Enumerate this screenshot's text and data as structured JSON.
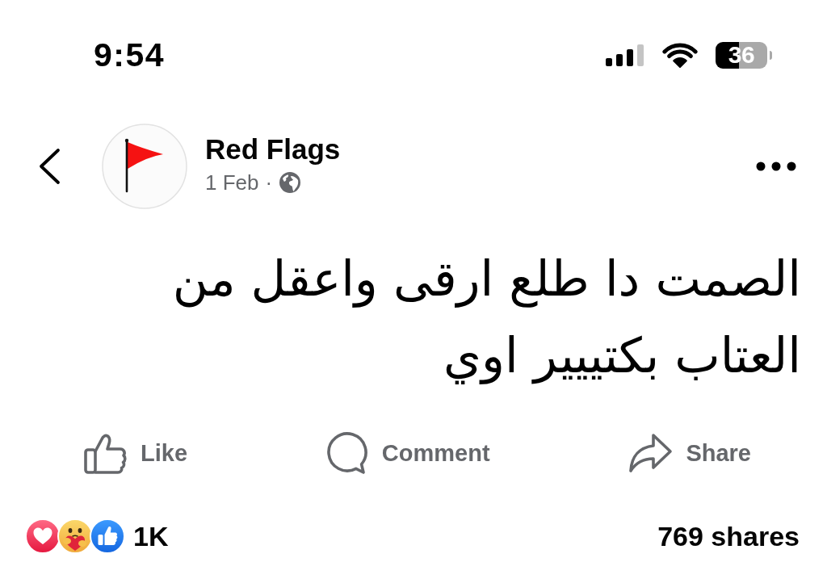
{
  "status_bar": {
    "time": "9:54",
    "battery": "36"
  },
  "post_header": {
    "page_name": "Red Flags",
    "date": "1 Feb",
    "separator": "·"
  },
  "post": {
    "text": "الصمت دا طلع ارقى واعقل من العتاب بكتييير اوي"
  },
  "actions": [
    {
      "kind": "like",
      "label": "Like"
    },
    {
      "kind": "comment",
      "label": "Comment"
    },
    {
      "kind": "share",
      "label": "Share"
    }
  ],
  "footer": {
    "reactions": [
      {
        "kind": "love"
      },
      {
        "kind": "care"
      },
      {
        "kind": "like"
      }
    ],
    "reaction_count": "1K",
    "shares": "769 shares"
  }
}
